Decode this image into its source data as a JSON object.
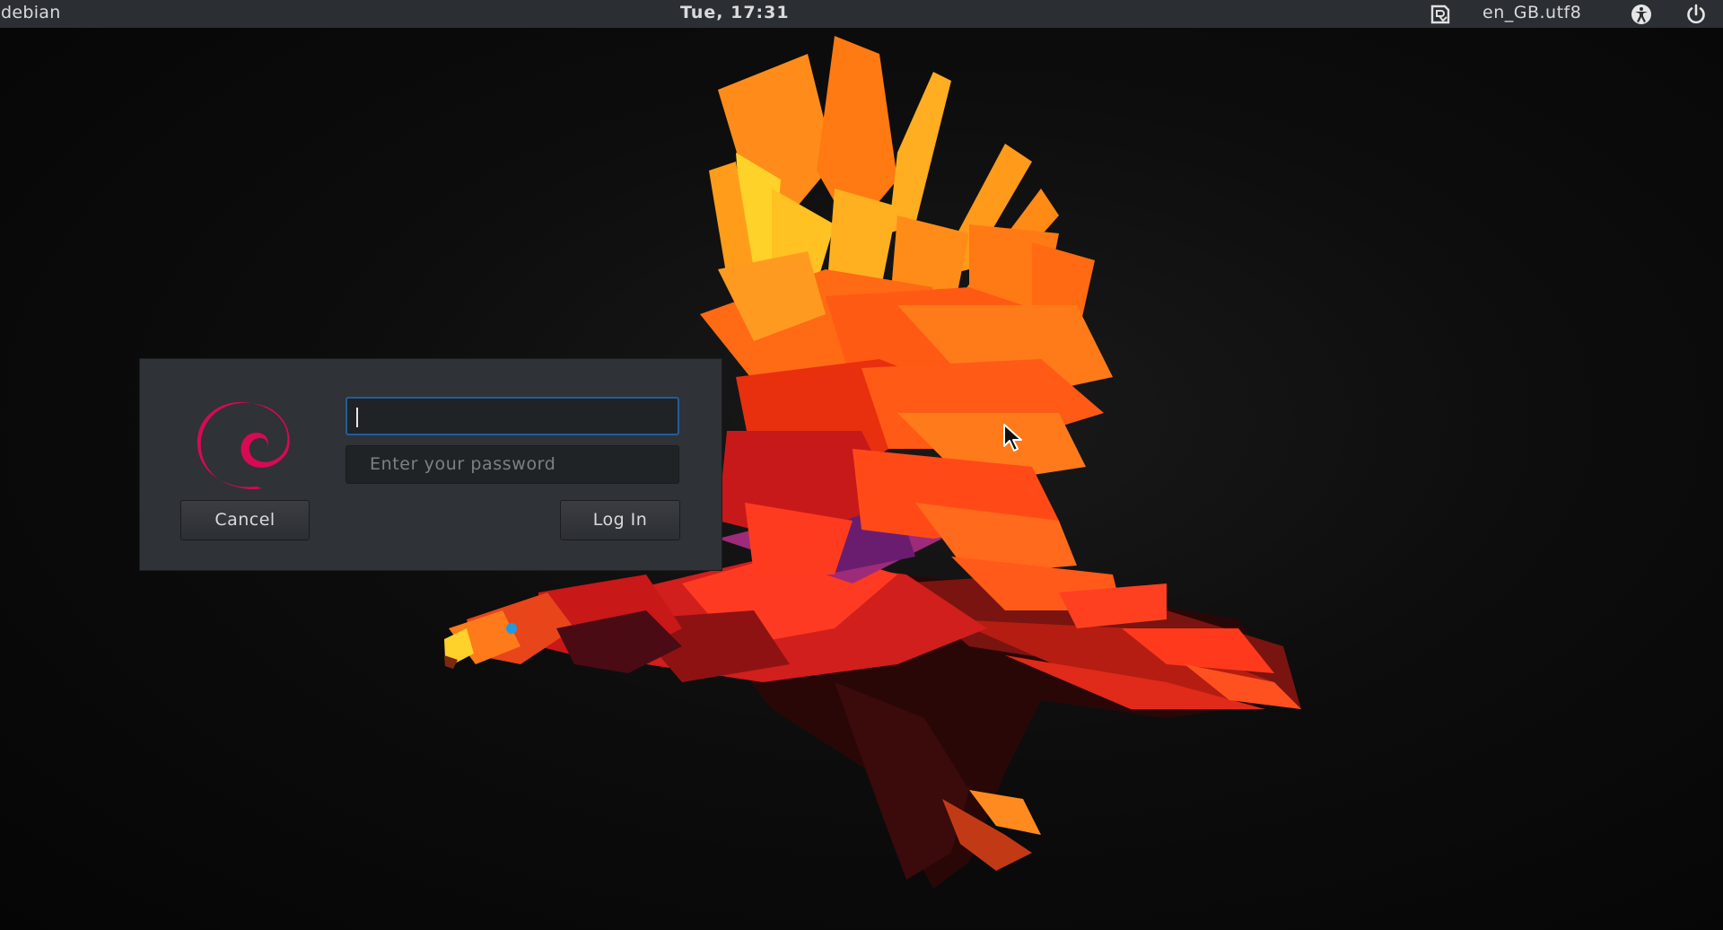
{
  "topbar": {
    "hostname": "debian",
    "clock": "Tue, 17:31",
    "keyboard_icon": "keyboard-layout-icon",
    "locale": "en_GB.utf8",
    "accessibility_icon": "accessibility-icon",
    "power_icon": "power-icon"
  },
  "wallpaper": {
    "subject": "phoenix-icon"
  },
  "login": {
    "logo_icon": "debian-swirl-icon",
    "username_value": "",
    "password_placeholder": "Enter your password",
    "cancel_label": "Cancel",
    "login_label": "Log In"
  },
  "colors": {
    "topbar_bg": "#2b2e33",
    "dialog_bg": "#2f3236",
    "focus_border": "#215d9c",
    "debian_red": "#d70a53"
  }
}
